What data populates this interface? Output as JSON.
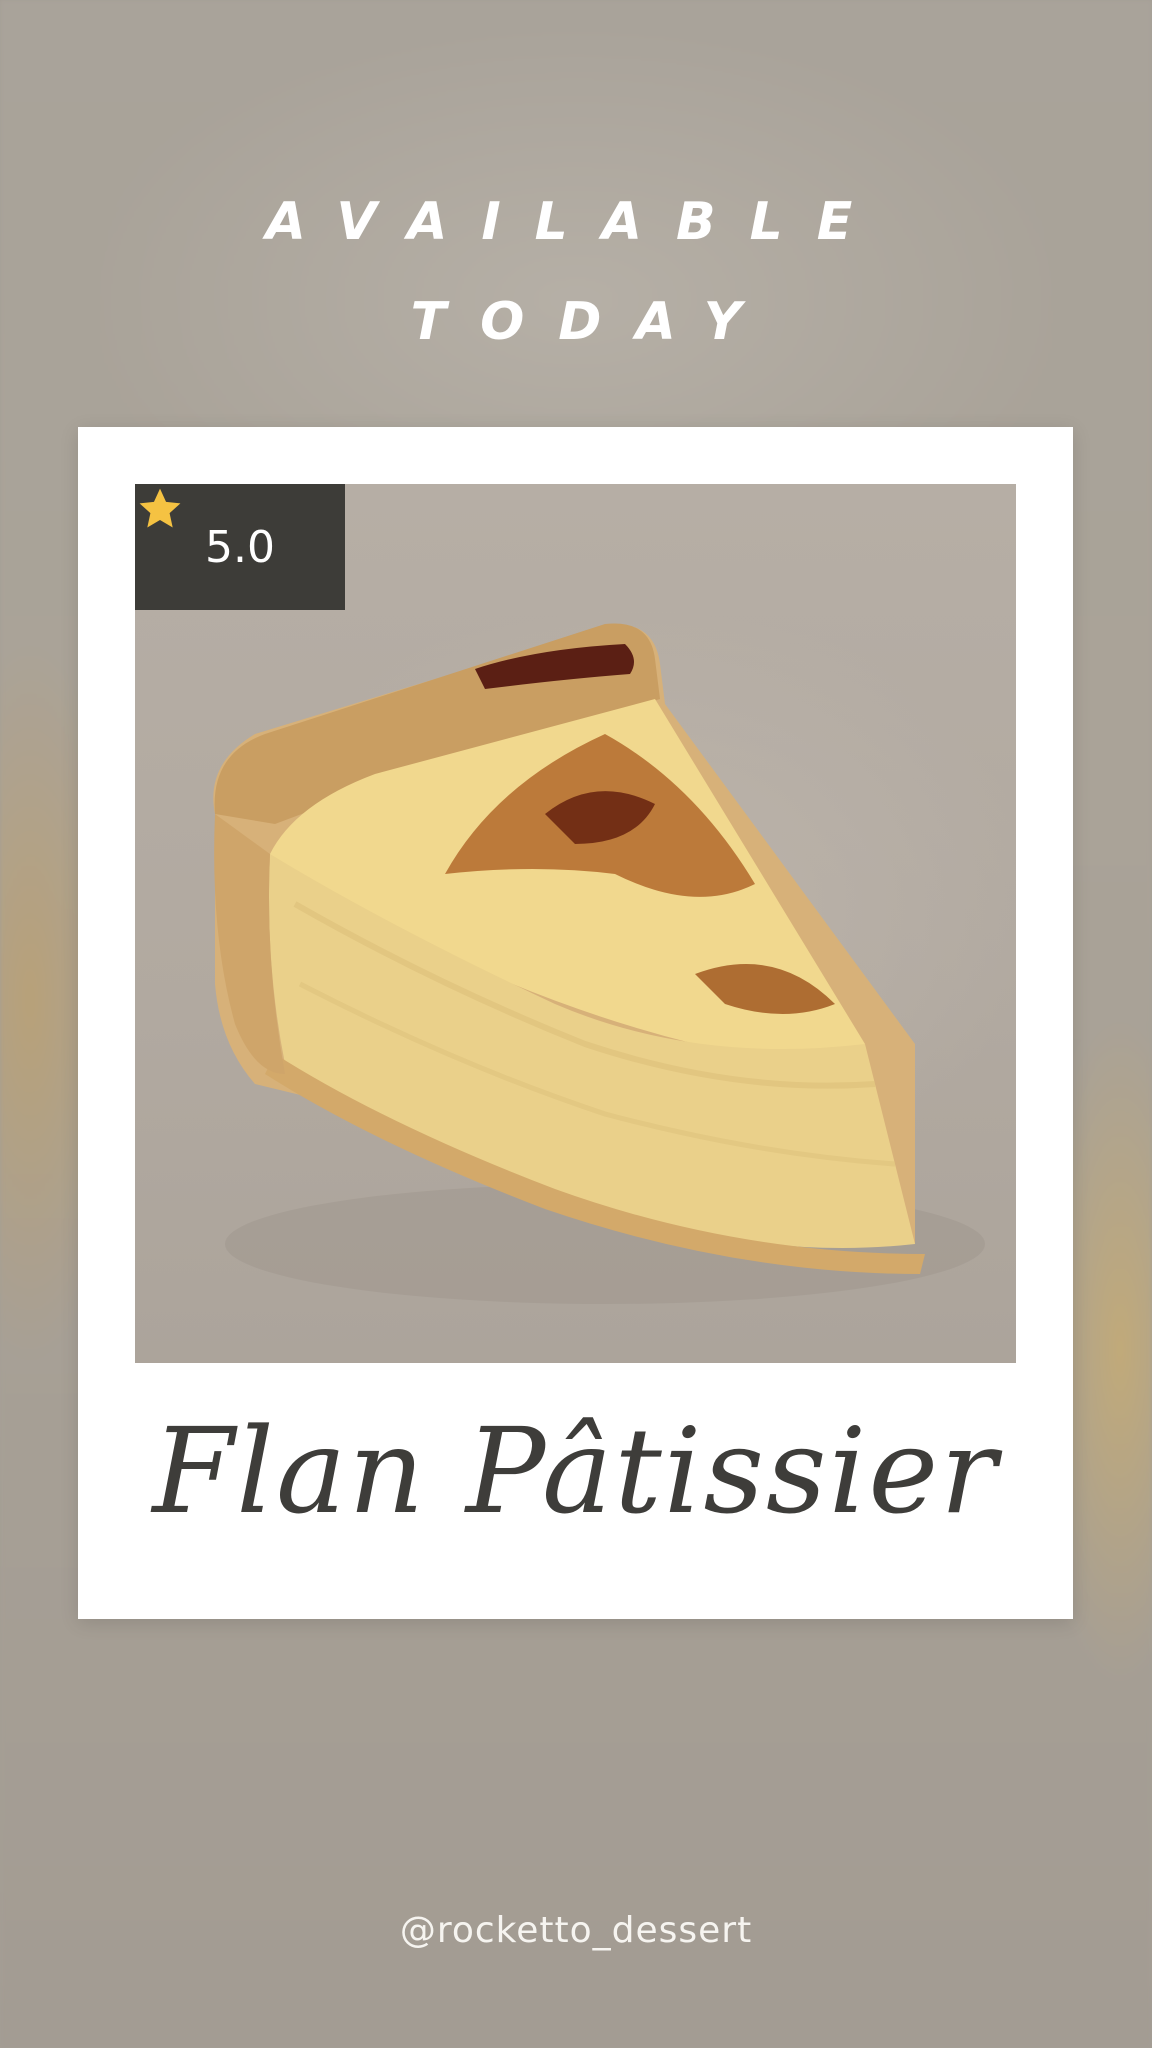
{
  "headline": {
    "line1": "AVAILABLE",
    "line2": "TODAY"
  },
  "card": {
    "rating": {
      "icon": "star-icon",
      "value": "5.0",
      "star_color": "#f5c242",
      "badge_color": "#3d3c38"
    },
    "product_name": "Flan Pâtissier",
    "photo_subject": "flan-slice-image"
  },
  "footer": {
    "handle": "@rocketto_dessert"
  },
  "colors": {
    "background": "#a49e95",
    "card": "#ffffff",
    "text_dark": "#3e3d3a",
    "text_light": "#ffffff"
  }
}
